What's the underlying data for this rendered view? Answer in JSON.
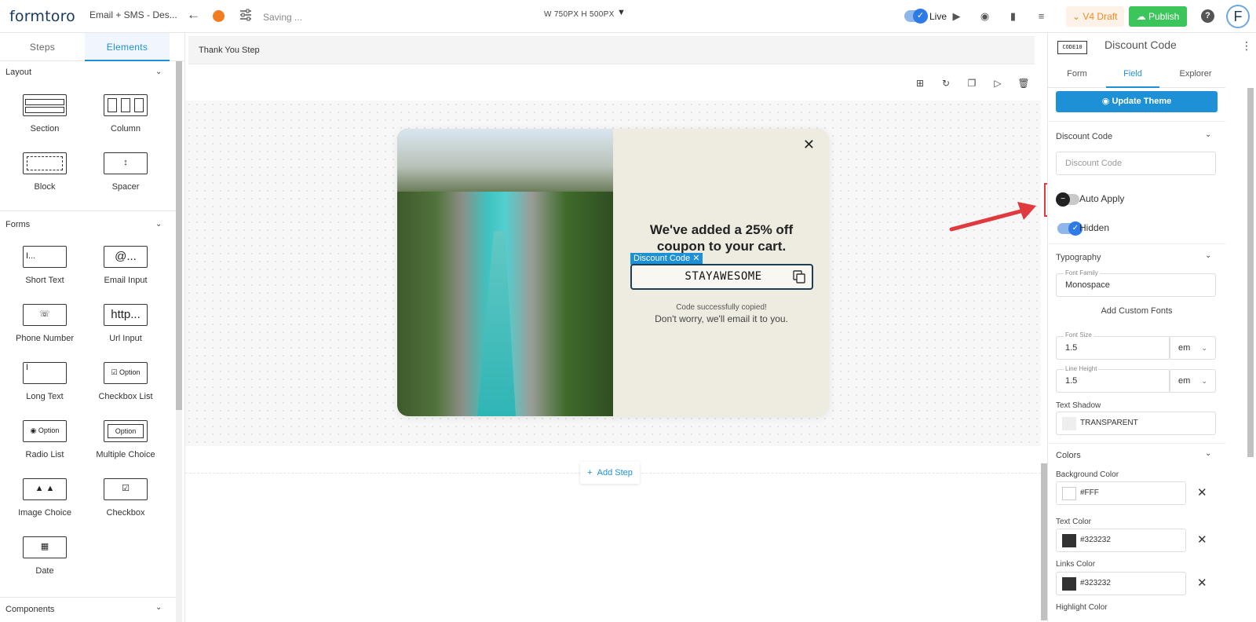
{
  "app": {
    "logo": "formtoro",
    "form_name": "Email + SMS - Des...",
    "saving": "Saving ...",
    "dimensions": "W 750PX  H 500PX",
    "live_label": "Live",
    "draft_label": "V4 Draft",
    "publish_label": "Publish",
    "avatar_letter": "F",
    "status_color": "#f47c20",
    "accent": "#1e90d6"
  },
  "left": {
    "tabs": [
      "Steps",
      "Elements"
    ],
    "active_tab": "Elements",
    "sections": {
      "layout": "Layout",
      "forms": "Forms",
      "components": "Components"
    },
    "layout_items": [
      "Section",
      "Column",
      "Block",
      "Spacer"
    ],
    "form_items": [
      "Short Text",
      "Email Input",
      "Phone Number",
      "Url Input",
      "Long Text",
      "Checkbox List",
      "Radio List",
      "Multiple Choice",
      "Image Choice",
      "Checkbox",
      "Date"
    ],
    "icon_text": {
      "short_text": "I...",
      "email": "@...",
      "url": "http...",
      "option": "Option"
    }
  },
  "canvas": {
    "step_name": "Thank You Step",
    "popup": {
      "heading": "We've added a 25% off coupon to your cart.",
      "tag": "Discount Code",
      "code": "STAYAWESOME",
      "copied": "Code successfully copied!",
      "email_note": "Don't worry, we'll email it to you."
    },
    "add_step": "Add Step"
  },
  "right": {
    "badge": "CODE10",
    "title": "Discount Code",
    "tabs": [
      "Form",
      "Field",
      "Explorer"
    ],
    "active_tab": "Field",
    "update_theme": "Update Theme",
    "discount_section": "Discount Code",
    "discount_placeholder": "Discount Code",
    "auto_apply": {
      "label": "Auto Apply",
      "on": false
    },
    "hidden": {
      "label": "Hidden",
      "on": true
    },
    "typography": "Typography",
    "font_family_label": "Font Family",
    "font_family": "Monospace",
    "add_custom_fonts": "Add Custom Fonts",
    "font_size_label": "Font Size",
    "font_size": "1.5",
    "font_size_unit": "em",
    "line_height_label": "Line Height",
    "line_height": "1.5",
    "line_height_unit": "em",
    "text_shadow_label": "Text Shadow",
    "text_shadow": "TRANSPARENT",
    "colors": "Colors",
    "background_color_label": "Background Color",
    "background_color": "#FFF",
    "text_color_label": "Text Color",
    "text_color": "#323232",
    "links_color_label": "Links Color",
    "links_color": "#323232",
    "highlight_color_label": "Highlight Color"
  }
}
